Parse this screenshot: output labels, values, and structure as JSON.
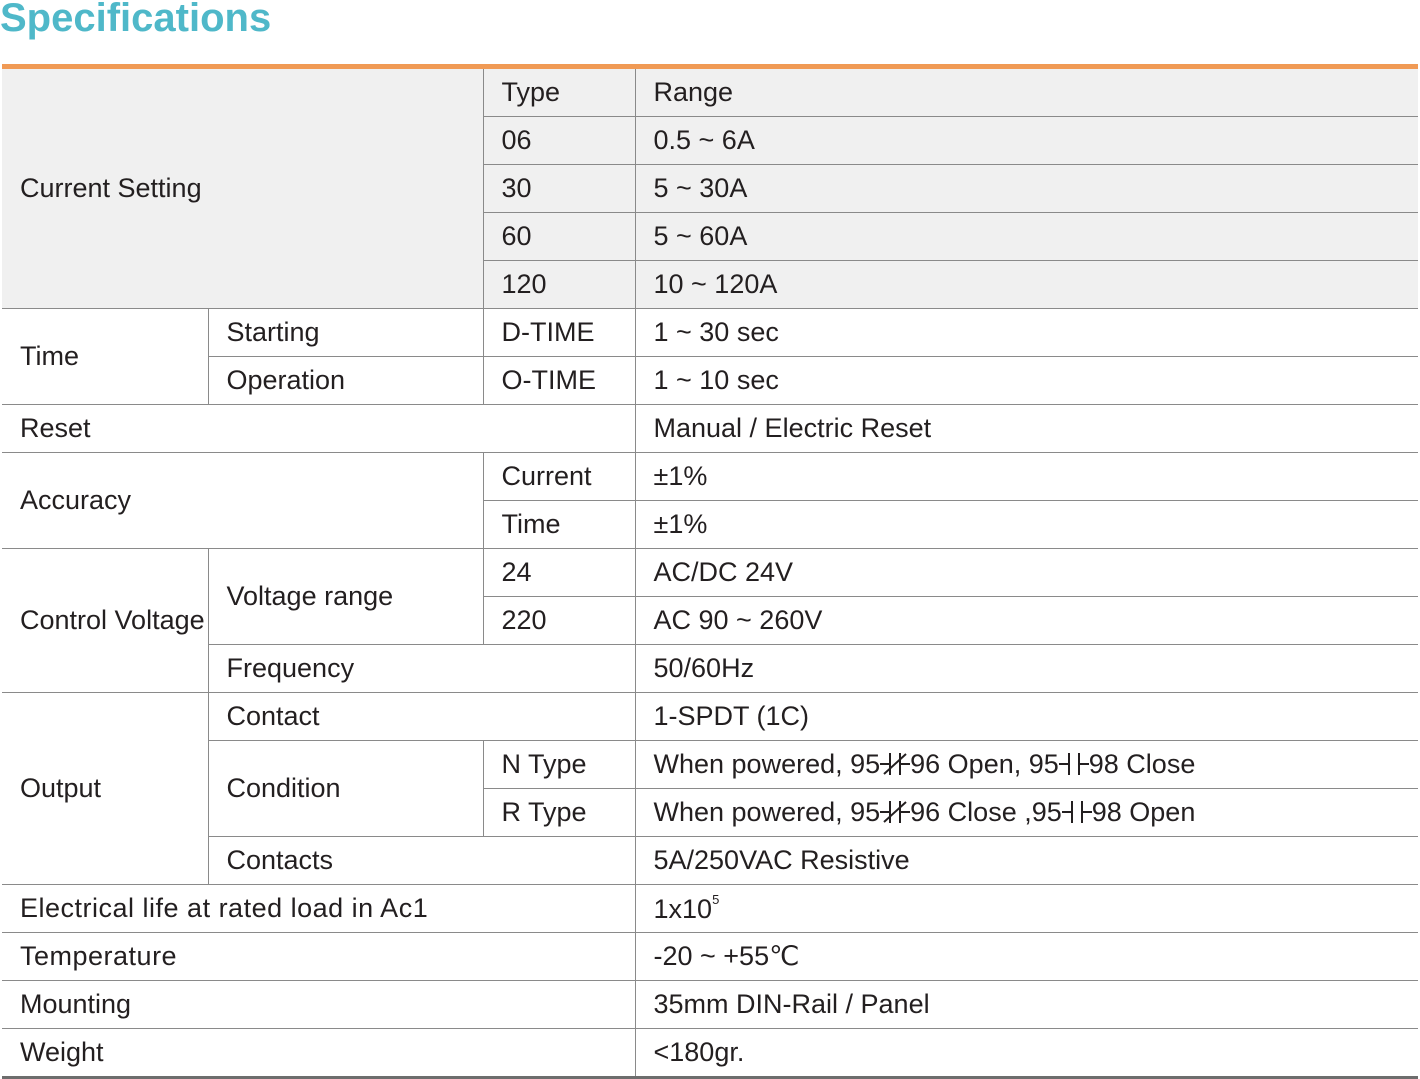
{
  "title": "Specifications",
  "table": {
    "current_setting": {
      "label": "Current Setting",
      "type_header": "Type",
      "range_header": "Range",
      "rows": [
        {
          "type": "06",
          "range": "0.5 ~ 6A"
        },
        {
          "type": "30",
          "range": "5 ~ 30A"
        },
        {
          "type": "60",
          "range": "5 ~ 60A"
        },
        {
          "type": "120",
          "range": "10 ~ 120A"
        }
      ]
    },
    "time": {
      "label": "Time",
      "starting": {
        "label": "Starting",
        "code": "D-TIME",
        "value": "1 ~ 30 sec"
      },
      "operation": {
        "label": "Operation",
        "code": "O-TIME",
        "value": "1 ~ 10 sec"
      }
    },
    "reset": {
      "label": "Reset",
      "value": "Manual / Electric Reset"
    },
    "accuracy": {
      "label": "Accuracy",
      "current": {
        "label": "Current",
        "value": "±1%"
      },
      "time": {
        "label": "Time",
        "value": "±1%"
      }
    },
    "control_voltage": {
      "label": "Control Voltage",
      "voltage_range_label": "Voltage range",
      "rows": [
        {
          "code": "24",
          "value": "AC/DC  24V"
        },
        {
          "code": "220",
          "value": "AC 90 ~ 260V"
        }
      ],
      "frequency": {
        "label": "Frequency",
        "value": "50/60Hz"
      }
    },
    "output": {
      "label": "Output",
      "contact": {
        "label": "Contact",
        "value": "1-SPDT (1C)"
      },
      "condition": {
        "label": "Condition",
        "n_type": {
          "label": "N Type",
          "prefix": "When powered, 95",
          "mid": "96 Open, 95",
          "suffix": "98 Close"
        },
        "r_type": {
          "label": "R Type",
          "prefix": "When powered, 95",
          "mid": "96 Close ,95",
          "suffix": "98 Open"
        }
      },
      "contacts": {
        "label": "Contacts",
        "value": "5A/250VAC Resistive"
      }
    },
    "electrical_life": {
      "label": "Electrical life at rated load in Ac1",
      "base": "1x10",
      "exponent": "5"
    },
    "temperature": {
      "label": "Temperature",
      "value": "-20 ~ +55℃"
    },
    "mounting": {
      "label": "Mounting",
      "value": "35mm DIN-Rail / Panel"
    },
    "weight": {
      "label": "Weight",
      "value": "<180gr."
    }
  }
}
